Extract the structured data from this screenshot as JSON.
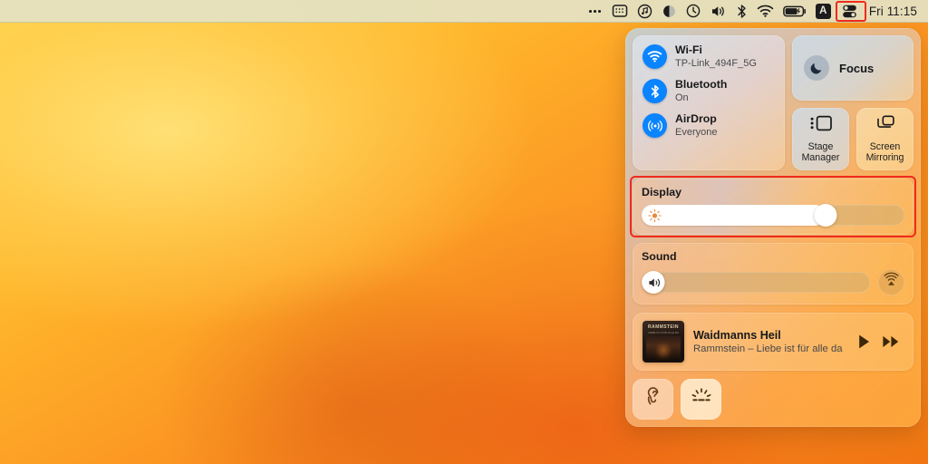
{
  "menubar": {
    "items": [
      {
        "name": "ellipsis-icon",
        "label": "•••"
      },
      {
        "name": "calculator-icon",
        "label": "Calculator"
      },
      {
        "name": "music-note-icon",
        "label": "Music"
      },
      {
        "name": "dark-mode-icon",
        "label": "Appearance"
      },
      {
        "name": "clock-icon",
        "label": "Clock"
      },
      {
        "name": "volume-icon",
        "label": "Volume"
      },
      {
        "name": "bluetooth-icon",
        "label": "Bluetooth"
      },
      {
        "name": "wifi-icon",
        "label": "Wi-Fi"
      },
      {
        "name": "battery-icon",
        "label": "Battery"
      },
      {
        "name": "input-source-badge",
        "label": "A"
      },
      {
        "name": "control-center-icon",
        "label": "Control Center"
      }
    ],
    "input_source": "A",
    "clock": "Fri 11:15",
    "highlight_color": "#ef2b1d"
  },
  "control_center": {
    "connectivity": [
      {
        "icon": "wifi-icon",
        "title": "Wi-Fi",
        "subtitle": "TP-Link_494F_5G"
      },
      {
        "icon": "bluetooth-icon",
        "title": "Bluetooth",
        "subtitle": "On"
      },
      {
        "icon": "airdrop-icon",
        "title": "AirDrop",
        "subtitle": "Everyone"
      }
    ],
    "focus": {
      "label": "Focus",
      "icon": "moon-icon"
    },
    "stage_manager": {
      "label": "Stage Manager",
      "icon": "stage-manager-icon"
    },
    "screen_mirroring": {
      "label": "Screen Mirroring",
      "icon": "screen-mirroring-icon"
    },
    "display": {
      "label": "Display",
      "slider_value": 70,
      "slider_icon": "brightness-icon",
      "highlighted": true
    },
    "sound": {
      "label": "Sound",
      "slider_value": 8,
      "slider_icon": "speaker-icon",
      "output_button_icon": "airplay-icon"
    },
    "now_playing": {
      "album_art_title": "RAMMSTEIN",
      "album_art_subtitle": "LIEBE IST FÜR ALLE DA",
      "track_title": "Waidmanns Heil",
      "track_artist": "Rammstein – Liebe ist für alle da",
      "play_button_icon": "play-icon",
      "next_button_icon": "fast-forward-icon"
    },
    "bottom_buttons": [
      {
        "name": "hearing-button",
        "icon": "ear-icon",
        "label": "Hearing"
      },
      {
        "name": "keyboard-brightness-button",
        "icon": "keyboard-brightness-icon",
        "label": "Keyboard Brightness"
      }
    ]
  }
}
